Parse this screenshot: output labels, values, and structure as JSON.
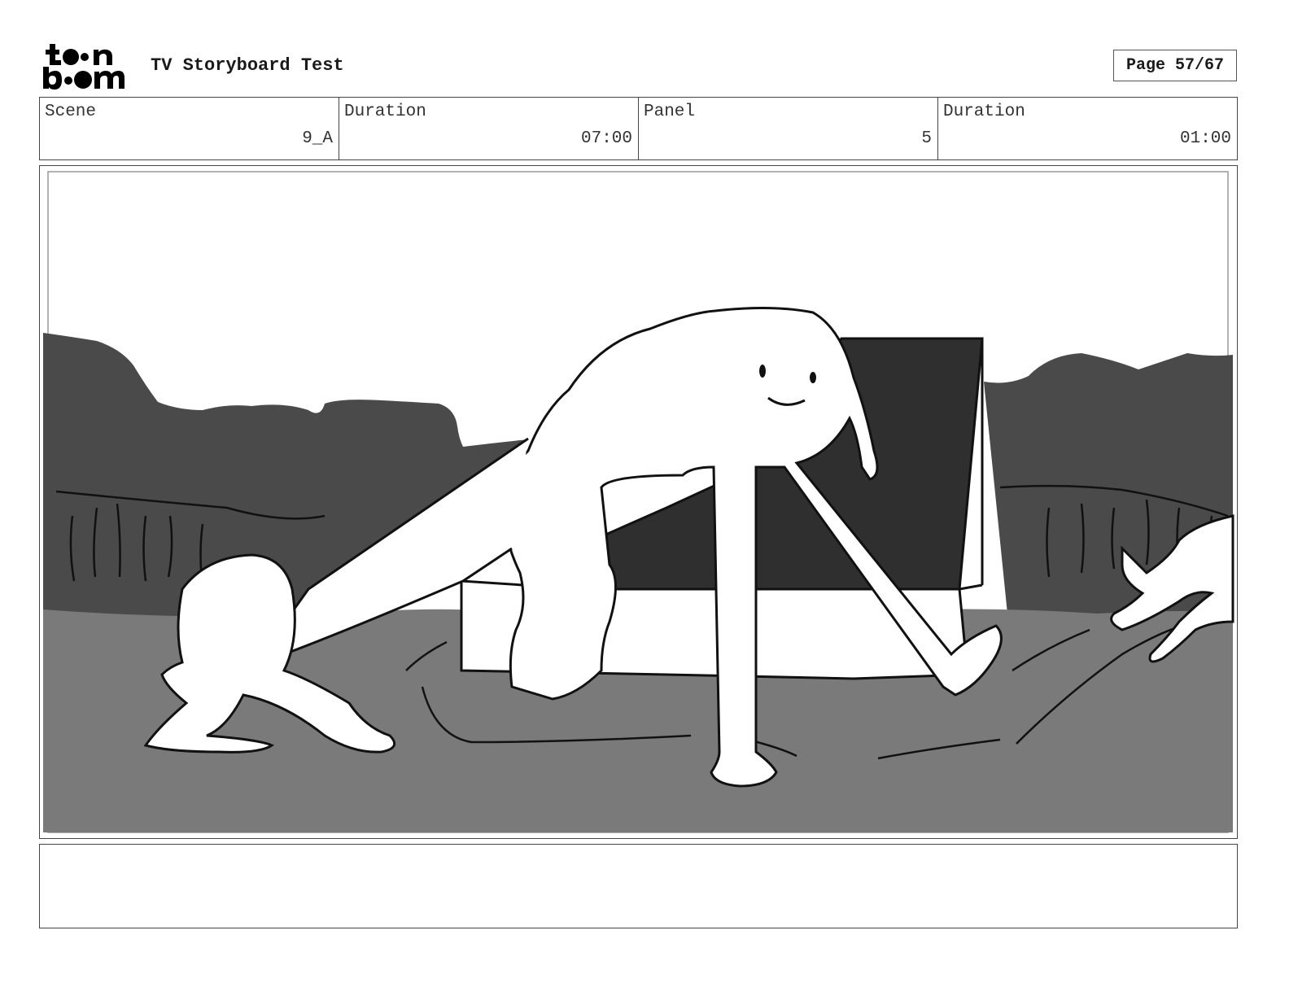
{
  "header": {
    "logo_text_top": "toon",
    "logo_text_bottom": "boom",
    "title": "TV Storyboard Test",
    "page_label": "Page 57/67"
  },
  "info": {
    "scene_label": "Scene",
    "scene_value": "9_A",
    "scene_duration_label": "Duration",
    "scene_duration_value": "07:00",
    "panel_label": "Panel",
    "panel_value": "5",
    "panel_duration_label": "Duration",
    "panel_duration_value": "01:00"
  },
  "panel_image": {
    "description_icon": "storyboard-sketch-image"
  },
  "notes": {
    "text": ""
  }
}
